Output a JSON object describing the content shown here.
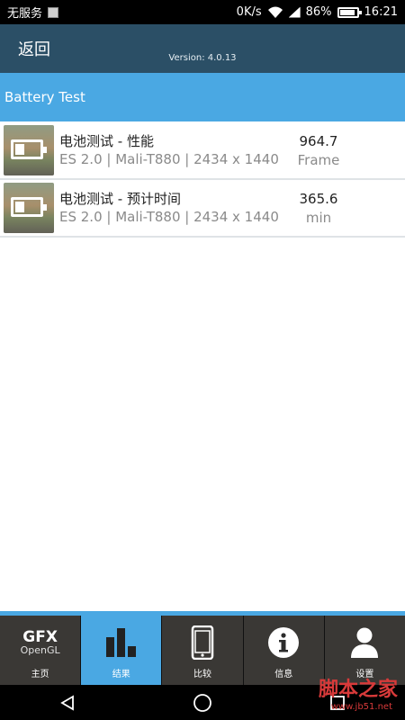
{
  "status": {
    "carrier": "无服务",
    "speed": "0K/s",
    "battery_pct": "86%",
    "time": "16:21"
  },
  "appbar": {
    "back_label": "返回",
    "version": "Version: 4.0.13"
  },
  "section": {
    "title": "Battery Test"
  },
  "results": [
    {
      "title": "电池测试 - 性能",
      "subtitle": "ES 2.0 | Mali-T880 | 2434 x 1440",
      "value": "964.7",
      "unit": "Frame"
    },
    {
      "title": "电池测试 - 预计时间",
      "subtitle": "ES 2.0 | Mali-T880 | 2434 x 1440",
      "value": "365.6",
      "unit": "min"
    }
  ],
  "tabs": [
    {
      "label": "主页",
      "icon": "gfx-opengl-logo",
      "line1": "GFX",
      "line2": "OpenGL"
    },
    {
      "label": "结果",
      "icon": "bar-chart-icon"
    },
    {
      "label": "比较",
      "icon": "phone-icon"
    },
    {
      "label": "信息",
      "icon": "info-icon"
    },
    {
      "label": "设置",
      "icon": "user-icon"
    }
  ],
  "active_tab": 1,
  "watermark": {
    "text": "脚本之家",
    "url": "www.jb51.net"
  },
  "colors": {
    "appbar": "#2b4f66",
    "accent": "#4aa8e3",
    "tabbar": "#3a3835"
  }
}
